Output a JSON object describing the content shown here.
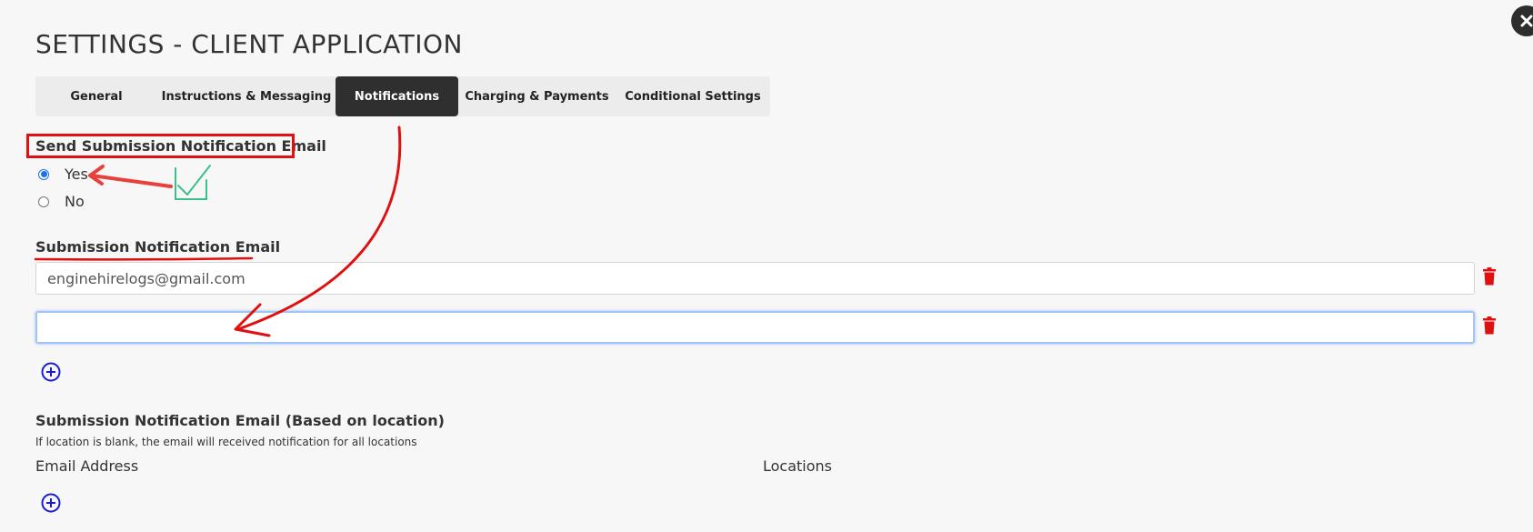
{
  "dialog": {
    "title": "SETTINGS - CLIENT APPLICATION"
  },
  "tabs": [
    {
      "label": "General",
      "active": false
    },
    {
      "label": "Instructions & Messaging",
      "active": false
    },
    {
      "label": "Notifications",
      "active": true
    },
    {
      "label": "Charging & Payments",
      "active": false
    },
    {
      "label": "Conditional Settings",
      "active": false
    }
  ],
  "send_notification": {
    "label": "Send Submission Notification Email",
    "options": [
      {
        "label": "Yes",
        "checked": true
      },
      {
        "label": "No",
        "checked": false
      }
    ]
  },
  "submission_email": {
    "label": "Submission Notification Email",
    "inputs": [
      {
        "value": "enginehirelogs@gmail.com"
      },
      {
        "value": ""
      }
    ]
  },
  "location_email": {
    "label": "Submission Notification Email (Based on location)",
    "hint": "If location is blank, the email will received notification for all locations",
    "columns": [
      "Email Address",
      "Locations"
    ]
  },
  "colors": {
    "accent": "#1a73e8",
    "add_icon": "#1a1ad6",
    "delete_icon": "#e01010",
    "active_tab": "#2f2f2f",
    "annotation_red": "#e01010",
    "annotation_green": "#3cc08a"
  },
  "icons": {
    "close": "close-icon",
    "delete": "trash-icon",
    "add": "plus-circle-icon"
  }
}
